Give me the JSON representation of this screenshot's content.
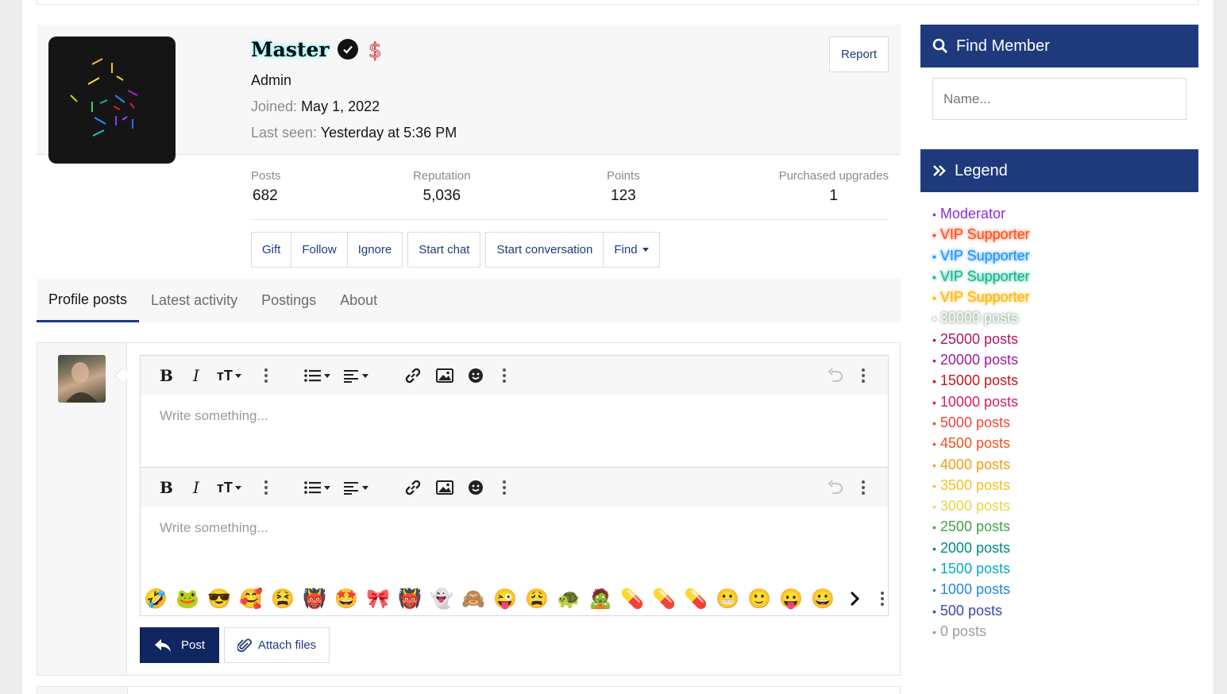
{
  "profile": {
    "username": "Master",
    "role": "Admin",
    "joined_label": "Joined:",
    "joined_value": "May 1, 2022",
    "seen_label": "Last seen:",
    "seen_value": "Yesterday at 5:36 PM",
    "report_label": "Report",
    "stats": [
      {
        "label": "Posts",
        "value": "682"
      },
      {
        "label": "Reputation",
        "value": "5,036"
      },
      {
        "label": "Points",
        "value": "123"
      },
      {
        "label": "Purchased upgrades",
        "value": "1"
      }
    ],
    "actions": [
      "Gift",
      "Follow",
      "Ignore",
      "Start chat",
      "Start conversation",
      "Find"
    ]
  },
  "tabs": [
    "Profile posts",
    "Latest activity",
    "Postings",
    "About"
  ],
  "composer": {
    "placeholder": "Write something...",
    "post_label": "Post",
    "attach_label": "Attach files",
    "smilies": [
      "🤣",
      "🐸",
      "😎",
      "🥰",
      "😫",
      "👹",
      "🤩",
      "🎀",
      "👹",
      "👻",
      "🙈",
      "😜",
      "😩",
      "🐢",
      "🧟",
      "💊",
      "💊",
      "💊",
      "😬",
      "🙂",
      "😛",
      "😀"
    ]
  },
  "sidebar": {
    "find_member_title": "Find Member",
    "name_placeholder": "Name...",
    "legend_title": "Legend",
    "legend": [
      {
        "label": "Moderator",
        "color": "#8a2be2"
      },
      {
        "label": "VIP Supporter",
        "color": "#ff4a1a"
      },
      {
        "label": "VIP Supporter",
        "color": "#1e90ff"
      },
      {
        "label": "VIP Supporter",
        "color": "#11b58a"
      },
      {
        "label": "VIP Supporter",
        "color": "#ffb300"
      },
      {
        "label": "30000 posts",
        "color": "#ffffff"
      },
      {
        "label": "25000 posts",
        "color": "#b0155a"
      },
      {
        "label": "20000 posts",
        "color": "#9a1b9a"
      },
      {
        "label": "15000 posts",
        "color": "#c4161c"
      },
      {
        "label": "10000 posts",
        "color": "#d81b60"
      },
      {
        "label": "5000 posts",
        "color": "#f44336"
      },
      {
        "label": "4500 posts",
        "color": "#f4511e"
      },
      {
        "label": "4000 posts",
        "color": "#f39c12"
      },
      {
        "label": "3500 posts",
        "color": "#f6bf26"
      },
      {
        "label": "3000 posts",
        "color": "#e5d64a"
      },
      {
        "label": "2500 posts",
        "color": "#43a047"
      },
      {
        "label": "2000 posts",
        "color": "#00897b"
      },
      {
        "label": "1500 posts",
        "color": "#00acc1"
      },
      {
        "label": "1000 posts",
        "color": "#1e88e5"
      },
      {
        "label": "500 posts",
        "color": "#3949ab"
      },
      {
        "label": "0 posts",
        "color": "#9e9e9e"
      }
    ]
  }
}
